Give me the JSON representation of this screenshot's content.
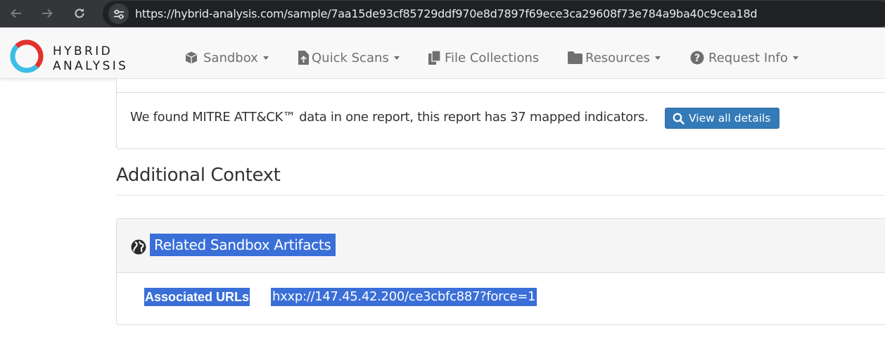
{
  "browser": {
    "url": "https://hybrid-analysis.com/sample/7aa15de93cf85729ddf970e8d7897f69ece3ca29608f73e784a9ba40c9cea18d",
    "back_icon": "arrow-left-icon",
    "forward_icon": "arrow-right-icon",
    "reload_icon": "reload-icon",
    "site_info_icon": "tune-icon"
  },
  "brand": {
    "line1": "HYBRID",
    "line2": "ANALYSIS",
    "colors": {
      "ring_red": "#e3312d",
      "ring_cyan": "#3bbde8"
    }
  },
  "nav": {
    "items": [
      {
        "label": "Sandbox",
        "icon": "cube-icon",
        "dropdown": true
      },
      {
        "label": "Quick Scans",
        "icon": "file-upload-icon",
        "dropdown": true
      },
      {
        "label": "File Collections",
        "icon": "files-icon",
        "dropdown": false
      },
      {
        "label": "Resources",
        "icon": "folder-icon",
        "dropdown": true
      },
      {
        "label": "Request Info",
        "icon": "question-circle-icon",
        "dropdown": true
      }
    ]
  },
  "mitre": {
    "text": "We found MITRE ATT&CK™ data in one report, this report has 37 mapped indicators.",
    "button_label": "View all details",
    "button_icon": "search-icon"
  },
  "additional_context": {
    "title": "Additional Context"
  },
  "artifacts": {
    "title": "Related Sandbox Artifacts",
    "icon": "globe-icon",
    "label": "Associated URLs",
    "value": "hxxp://147.45.42.200/ce3cbfc887?force=1"
  },
  "colors": {
    "primary_button": "#337ab7",
    "selection_highlight": "#3a6fd8",
    "browser_chrome": "#35363a"
  }
}
